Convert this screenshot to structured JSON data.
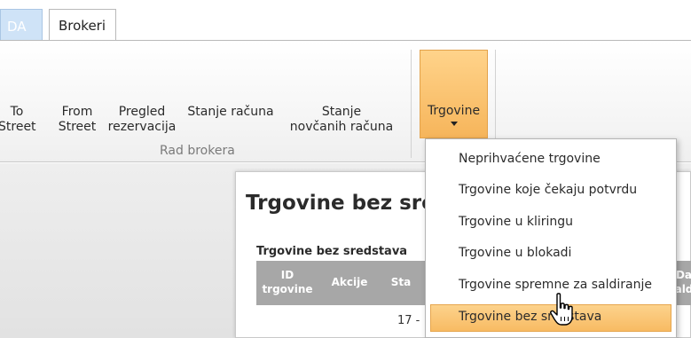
{
  "tabs": [
    {
      "label": "DA"
    },
    {
      "label": "Brokeri"
    }
  ],
  "ribbon": {
    "buttons": [
      {
        "line1": "To",
        "line2": "Street"
      },
      {
        "line1": "From",
        "line2": "Street"
      },
      {
        "line1": "Pregled",
        "line2": "rezervacija"
      },
      {
        "line1": "Stanje računa",
        "line2": ""
      },
      {
        "line1": "Stanje",
        "line2": "novčanih računa"
      },
      {
        "line1": "Trgovine",
        "line2": ""
      }
    ],
    "group_label": "Rad brokera"
  },
  "page": {
    "title": "Trgovine bez sre",
    "subtitle": "Trgovine bez sredstava",
    "columns": [
      {
        "line1": "ID",
        "line2": "trgovine"
      },
      {
        "line1": "Akcije",
        "line2": ""
      },
      {
        "line1": "Sta",
        "line2": ""
      },
      {
        "line1": "Da",
        "line2": "ald"
      }
    ],
    "first_cell": "17 -"
  },
  "menu": {
    "items": [
      {
        "label": "Neprihvaćene trgovine",
        "highlighted": false
      },
      {
        "label": "Trgovine koje čekaju potvrdu",
        "highlighted": false
      },
      {
        "label": "Trgovine u kliringu",
        "highlighted": false
      },
      {
        "label": "Trgovine u blokadi",
        "highlighted": false
      },
      {
        "label": "Trgovine spremne za saldiranje",
        "highlighted": false
      },
      {
        "label": "Trgovine bez sredstava",
        "highlighted": true
      }
    ]
  },
  "colors": {
    "accent_orange": "#f8bb63",
    "table_header": "#a7a7a7"
  }
}
